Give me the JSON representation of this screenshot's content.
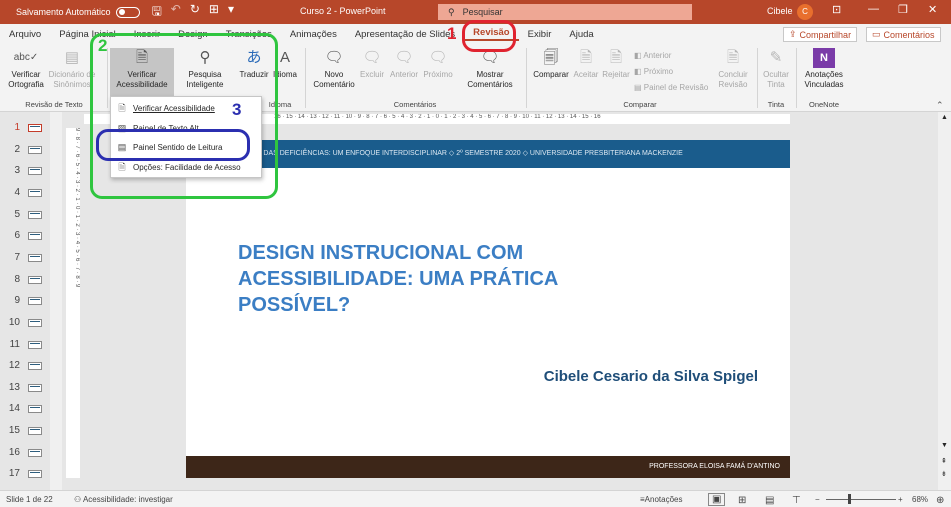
{
  "titlebar": {
    "autosave_label": "Salvamento Automático",
    "doc_title": "Curso 2 - PowerPoint",
    "search_placeholder": "Pesquisar",
    "user_name": "Cibele",
    "user_initial": "C"
  },
  "tabs": [
    "Arquivo",
    "Página Inicial",
    "Inserir",
    "Design",
    "Transições",
    "Animações",
    "Apresentação de Slides",
    "Revisão",
    "Exibir",
    "Ajuda"
  ],
  "active_tab": "Revisão",
  "share_button": "Compartilhar",
  "comments_button": "Comentários",
  "ribbon": {
    "groups": {
      "revisao_de_texto": "Revisão de Texto",
      "idioma": "Idioma",
      "comentarios": "Comentários",
      "comparar": "Comparar",
      "tinta": "Tinta",
      "onenote": "OneNote"
    },
    "verificar_ortografia": [
      "Verificar",
      "Ortografia"
    ],
    "dicionario": [
      "Dicionário de",
      "Sinônimos"
    ],
    "verificar_acessibilidade": [
      "Verificar",
      "Acessibilidade"
    ],
    "pesquisa_inteligente": [
      "Pesquisa",
      "Inteligente"
    ],
    "traduzir": "Traduzir",
    "idioma": "Idioma",
    "novo_comentario": [
      "Novo",
      "Comentário"
    ],
    "excluir": "Excluir",
    "anterior": "Anterior",
    "proximo": "Próximo",
    "mostrar_comentarios": [
      "Mostrar",
      "Comentários"
    ],
    "comparar": "Comparar",
    "aceitar": "Aceitar",
    "rejeitar": "Rejeitar",
    "cmp_anterior": "Anterior",
    "cmp_proximo": "Próximo",
    "painel_revisao": "Painel de Revisão",
    "concluir_revisao": [
      "Concluir",
      "Revisão"
    ],
    "ocultar_tinta": [
      "Ocultar",
      "Tinta"
    ],
    "anotacoes_vinculadas": [
      "Anotações",
      "Vinculadas"
    ]
  },
  "dropdown": {
    "items": [
      "Verificar Acessibilidade",
      "Painel de Texto Alt",
      "Painel Sentido de Leitura",
      "Opções: Facilidade de Acesso"
    ]
  },
  "annotations": {
    "n1": "1",
    "n2": "2",
    "n3": "3"
  },
  "thumbnails": [
    "1",
    "2",
    "3",
    "4",
    "5",
    "6",
    "7",
    "8",
    "9",
    "10",
    "11",
    "12",
    "13",
    "14",
    "15",
    "16",
    "17"
  ],
  "ruler": {
    "horizontal": "16 · 15 · 14 · 13 · 12 · 11 · 10 · 9 · 8 · 7 · 6 · 5 · 4 · 3 · 2 · 1 · 0 · 1 · 2 · 3 · 4 · 5 · 6 · 7 · 8 · 9 · 10 · 11 · 12 · 13 · 14 · 15 · 16",
    "vertical": "9 · 8 · 7 · 6 · 5 · 4 · 3 · 2 · 1 · 0 · 1 · 2 · 3 · 4 · 5 · 6 · 7 · 8 · 9"
  },
  "slide": {
    "header": "O DAS DEFICIÊNCIAS: UM ENFOQUE INTERDISCIPLINAR  ◇  2º SEMESTRE 2020  ◇  UNIVERSIDADE PRESBITERIANA MACKENZIE",
    "title": "DESIGN INSTRUCIONAL COM ACESSIBILIDADE: UMA PRÁTICA POSSÍVEL?",
    "author": "Cibele Cesario da Silva Spigel",
    "footer": "PROFESSORA ELOISA FAMÁ D'ANTINO"
  },
  "statusbar": {
    "slide_info": "Slide 1 de 22",
    "accessibility": "Acessibilidade: investigar",
    "notes": "Anotações",
    "zoom": "68%"
  },
  "colors": {
    "accent": "#b7472a",
    "slide_band": "#1a5c8c",
    "slide_title": "#3b7ec4",
    "footer_band": "#3d2618"
  }
}
